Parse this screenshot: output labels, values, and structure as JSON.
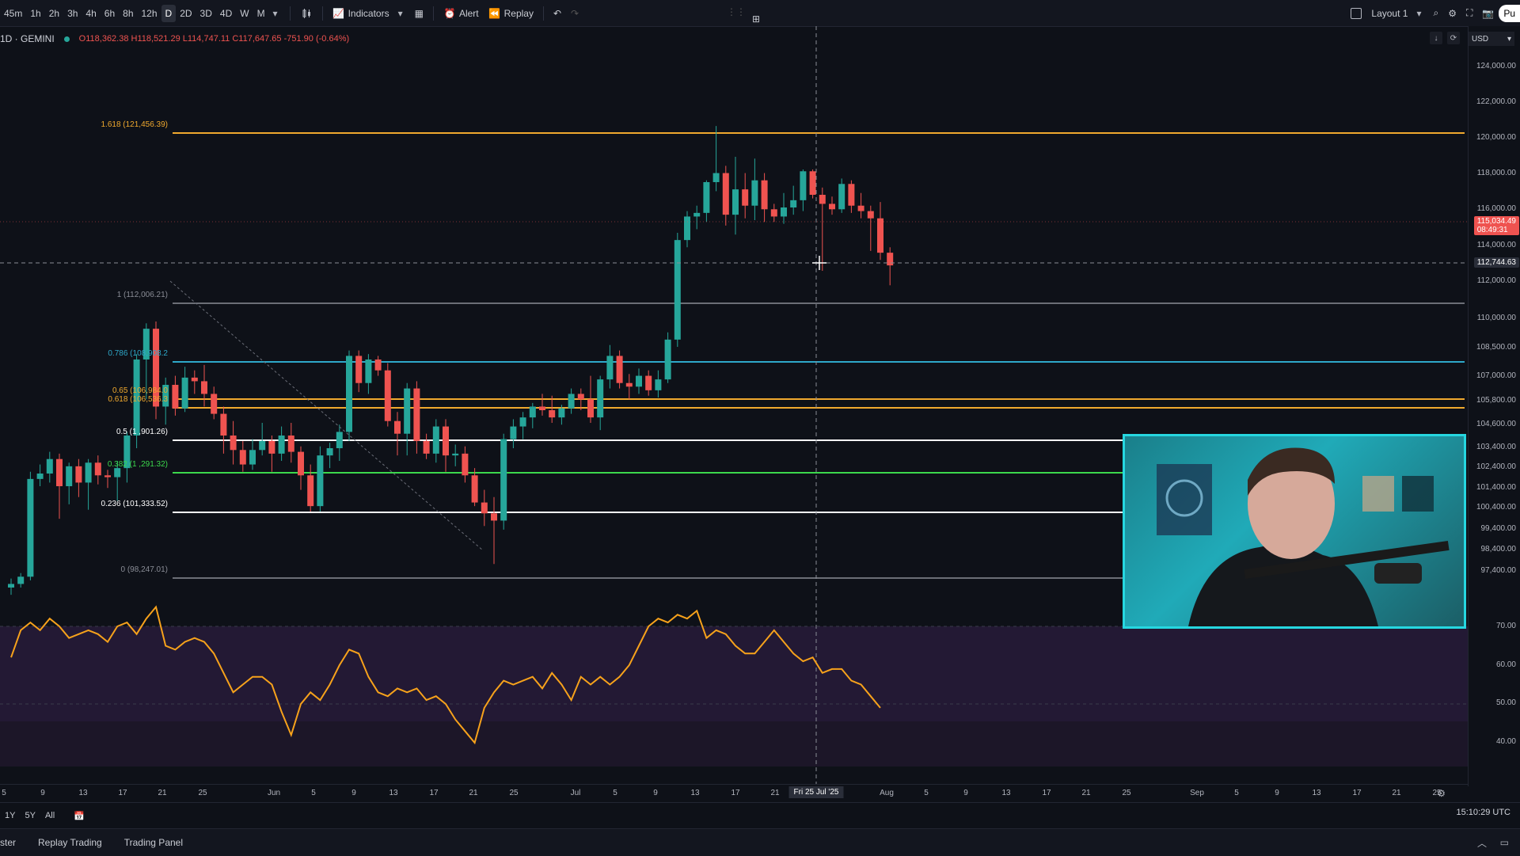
{
  "toolbar": {
    "intervals": [
      "45m",
      "1h",
      "2h",
      "3h",
      "4h",
      "6h",
      "8h",
      "12h",
      "D",
      "2D",
      "3D",
      "4D",
      "W",
      "M"
    ],
    "active_interval": "D",
    "indicators_label": "Indicators",
    "alert_label": "Alert",
    "replay_label": "Replay",
    "layout_label": "Layout 1",
    "publish_label": "Pu"
  },
  "symbol": {
    "name": "1D · GEMINI",
    "ohlc": "O118,362.38 H118,521.29 L114,747.11 C117,647.65 -751.90 (-0.64%)"
  },
  "currency": "USD",
  "price_axis": {
    "labels": [
      "124,000.00",
      "122,000.00",
      "120,000.00",
      "118,000.00",
      "116,000.00",
      "114,000.00",
      "112,000.00",
      "110,000.00",
      "108,500.00",
      "107,000.00",
      "105,800.00",
      "104,600.00",
      "103,400.00",
      "102,400.00",
      "101,400.00",
      "100,400.00",
      "99,400.00",
      "98,400.00",
      "97,400.00"
    ],
    "current_price": "115,034.49",
    "countdown": "08:49:31",
    "crosshair_price": "112,744.63",
    "rsi_labels": [
      "70.00",
      "60.00",
      "50.00",
      "40.00"
    ]
  },
  "fib_levels": [
    {
      "label": "1.618 (121,456.39)",
      "color": "#f0a92e"
    },
    {
      "label": "1 (112,006.21)",
      "color": "#8a8d96"
    },
    {
      "label": "0.786 (108,908.2",
      "color": "#2ea8c9"
    },
    {
      "label": "0.65 (106,984.0",
      "color": "#f0a92e"
    },
    {
      "label": "0.618 (106,536.3",
      "color": "#f0a92e"
    },
    {
      "label": "0.5 (1  ,901.26)",
      "color": "#ffffff"
    },
    {
      "label": "0.382 (1 ,291.32)",
      "color": "#3cd84c"
    },
    {
      "label": "0.236 (101,333.52)",
      "color": "#ffffff"
    },
    {
      "label": "0 (98,247.01)",
      "color": "#8a8d96"
    }
  ],
  "time_axis": {
    "labels": [
      "5",
      "9",
      "13",
      "17",
      "21",
      "25",
      "Jun",
      "5",
      "9",
      "13",
      "17",
      "21",
      "25",
      "Jul",
      "5",
      "9",
      "13",
      "17",
      "21",
      "Aug",
      "5",
      "9",
      "13",
      "17",
      "21",
      "25",
      "Sep",
      "5",
      "9",
      "13",
      "17",
      "21",
      "25"
    ],
    "crosshair_date": "Fri 25 Jul '25"
  },
  "range_bar": {
    "items": [
      "1Y",
      "5Y",
      "All"
    ],
    "clock": "15:10:29 UTC"
  },
  "bottom_bar": {
    "items": [
      "ster",
      "Replay Trading",
      "Trading Panel"
    ]
  },
  "colors": {
    "up": "#26a69a",
    "down": "#ef5350",
    "rsi_line": "#f7a21b",
    "rsi_band": "#2a1e3e",
    "webcam_border": "#26d7e0"
  },
  "chart_data": {
    "type": "candlestick",
    "ylim": [
      96500,
      124500
    ],
    "candles": [
      [
        97200,
        97700,
        96800,
        97400
      ],
      [
        97400,
        98000,
        97200,
        97800
      ],
      [
        97800,
        103600,
        97600,
        103200
      ],
      [
        103200,
        104000,
        102800,
        103500
      ],
      [
        103500,
        104700,
        103000,
        104300
      ],
      [
        104300,
        104600,
        101000,
        102800
      ],
      [
        102800,
        104100,
        101800,
        103900
      ],
      [
        103900,
        104300,
        102200,
        103000
      ],
      [
        103000,
        104300,
        101500,
        104100
      ],
      [
        104100,
        104500,
        102900,
        103400
      ],
      [
        103400,
        103700,
        102700,
        103300
      ],
      [
        103300,
        104200,
        102000,
        103800
      ],
      [
        103800,
        105800,
        103000,
        105600
      ],
      [
        105600,
        110100,
        104900,
        109800
      ],
      [
        109800,
        111800,
        107600,
        111500
      ],
      [
        111500,
        111900,
        106500,
        107200
      ],
      [
        107200,
        108800,
        106200,
        108400
      ],
      [
        108400,
        108900,
        106700,
        107100
      ],
      [
        107100,
        109400,
        106900,
        108800
      ],
      [
        108800,
        109200,
        107900,
        108600
      ],
      [
        108600,
        109500,
        107200,
        107900
      ],
      [
        107900,
        108300,
        106500,
        106800
      ],
      [
        106800,
        107200,
        104600,
        105600
      ],
      [
        105600,
        106400,
        104000,
        104800
      ],
      [
        104800,
        105300,
        103600,
        104000
      ],
      [
        104000,
        105400,
        103700,
        104800
      ],
      [
        104800,
        106300,
        104500,
        105300
      ],
      [
        105300,
        105600,
        103600,
        104600
      ],
      [
        104600,
        106100,
        104200,
        105600
      ],
      [
        105600,
        106300,
        104100,
        104700
      ],
      [
        104700,
        105000,
        102600,
        103400
      ],
      [
        103400,
        104000,
        101400,
        101700
      ],
      [
        101700,
        105000,
        101400,
        104500
      ],
      [
        104500,
        105200,
        103800,
        104900
      ],
      [
        104900,
        106200,
        104200,
        105800
      ],
      [
        105800,
        110300,
        105300,
        110000
      ],
      [
        110000,
        110300,
        108000,
        108500
      ],
      [
        108500,
        110100,
        107900,
        109800
      ],
      [
        109800,
        110000,
        108900,
        109200
      ],
      [
        109200,
        109600,
        106100,
        106400
      ],
      [
        106400,
        106900,
        104500,
        105700
      ],
      [
        105700,
        108500,
        104500,
        108200
      ],
      [
        108200,
        108600,
        104600,
        105300
      ],
      [
        105300,
        105700,
        104300,
        104600
      ],
      [
        104600,
        106500,
        104100,
        106100
      ],
      [
        106100,
        106500,
        103600,
        104500
      ],
      [
        104500,
        105100,
        103900,
        104600
      ],
      [
        104600,
        105000,
        103000,
        103400
      ],
      [
        103400,
        103800,
        101700,
        101900
      ],
      [
        101900,
        102600,
        100600,
        101300
      ],
      [
        101300,
        102200,
        98500,
        100900
      ],
      [
        100900,
        105700,
        100400,
        105400
      ],
      [
        105400,
        106500,
        104900,
        106100
      ],
      [
        106100,
        106900,
        105400,
        106600
      ],
      [
        106600,
        107400,
        106000,
        107200
      ],
      [
        107200,
        107900,
        106700,
        107000
      ],
      [
        107000,
        107800,
        106300,
        106600
      ],
      [
        106600,
        107300,
        106200,
        107100
      ],
      [
        107100,
        108200,
        106800,
        107900
      ],
      [
        107900,
        108200,
        107000,
        107600
      ],
      [
        107600,
        108900,
        106300,
        106600
      ],
      [
        106600,
        108900,
        105900,
        108700
      ],
      [
        108700,
        110600,
        108200,
        110000
      ],
      [
        110000,
        110300,
        108200,
        108500
      ],
      [
        108500,
        109000,
        107600,
        108300
      ],
      [
        108300,
        109300,
        107900,
        108900
      ],
      [
        108900,
        109200,
        107800,
        108100
      ],
      [
        108100,
        109200,
        107700,
        108700
      ],
      [
        108700,
        111300,
        108500,
        110900
      ],
      [
        110900,
        116800,
        110500,
        116400
      ],
      [
        116400,
        118000,
        116000,
        117700
      ],
      [
        117700,
        118300,
        117000,
        117900
      ],
      [
        117900,
        119700,
        117400,
        119600
      ],
      [
        119600,
        122700,
        119100,
        120100
      ],
      [
        120100,
        120500,
        117200,
        117800
      ],
      [
        117800,
        121000,
        116700,
        119200
      ],
      [
        119200,
        120100,
        117600,
        118300
      ],
      [
        118300,
        120900,
        117500,
        119700
      ],
      [
        119700,
        120100,
        117400,
        118100
      ],
      [
        118100,
        118400,
        117400,
        117700
      ],
      [
        117700,
        119000,
        117300,
        118200
      ],
      [
        118200,
        119400,
        117800,
        118600
      ],
      [
        118600,
        120300,
        118000,
        120200
      ],
      [
        120200,
        120300,
        118700,
        118900
      ],
      [
        118900,
        119300,
        114700,
        118400
      ],
      [
        118400,
        118800,
        117800,
        118100
      ],
      [
        118100,
        119800,
        117900,
        119500
      ],
      [
        119500,
        119700,
        117900,
        118300
      ],
      [
        118300,
        119000,
        117600,
        118000
      ],
      [
        118000,
        118300,
        115800,
        117600
      ],
      [
        117600,
        118500,
        115300,
        115700
      ],
      [
        115700,
        116000,
        113900,
        115000
      ]
    ],
    "rsi": [
      62,
      69,
      71,
      69,
      72,
      70,
      67,
      68,
      69,
      68,
      66,
      70,
      71,
      68,
      72,
      75,
      65,
      64,
      66,
      67,
      66,
      63,
      58,
      53,
      55,
      57,
      57,
      55,
      48,
      42,
      50,
      53,
      51,
      55,
      60,
      64,
      63,
      57,
      53,
      52,
      54,
      53,
      54,
      51,
      52,
      50,
      46,
      43,
      40,
      49,
      53,
      56,
      55,
      56,
      57,
      54,
      58,
      55,
      51,
      57,
      55,
      57,
      55,
      57,
      60,
      65,
      70,
      72,
      71,
      73,
      72,
      74,
      67,
      69,
      68,
      65,
      63,
      63,
      66,
      69,
      66,
      63,
      61,
      62,
      58,
      59,
      59,
      56,
      55,
      52,
      49
    ]
  }
}
